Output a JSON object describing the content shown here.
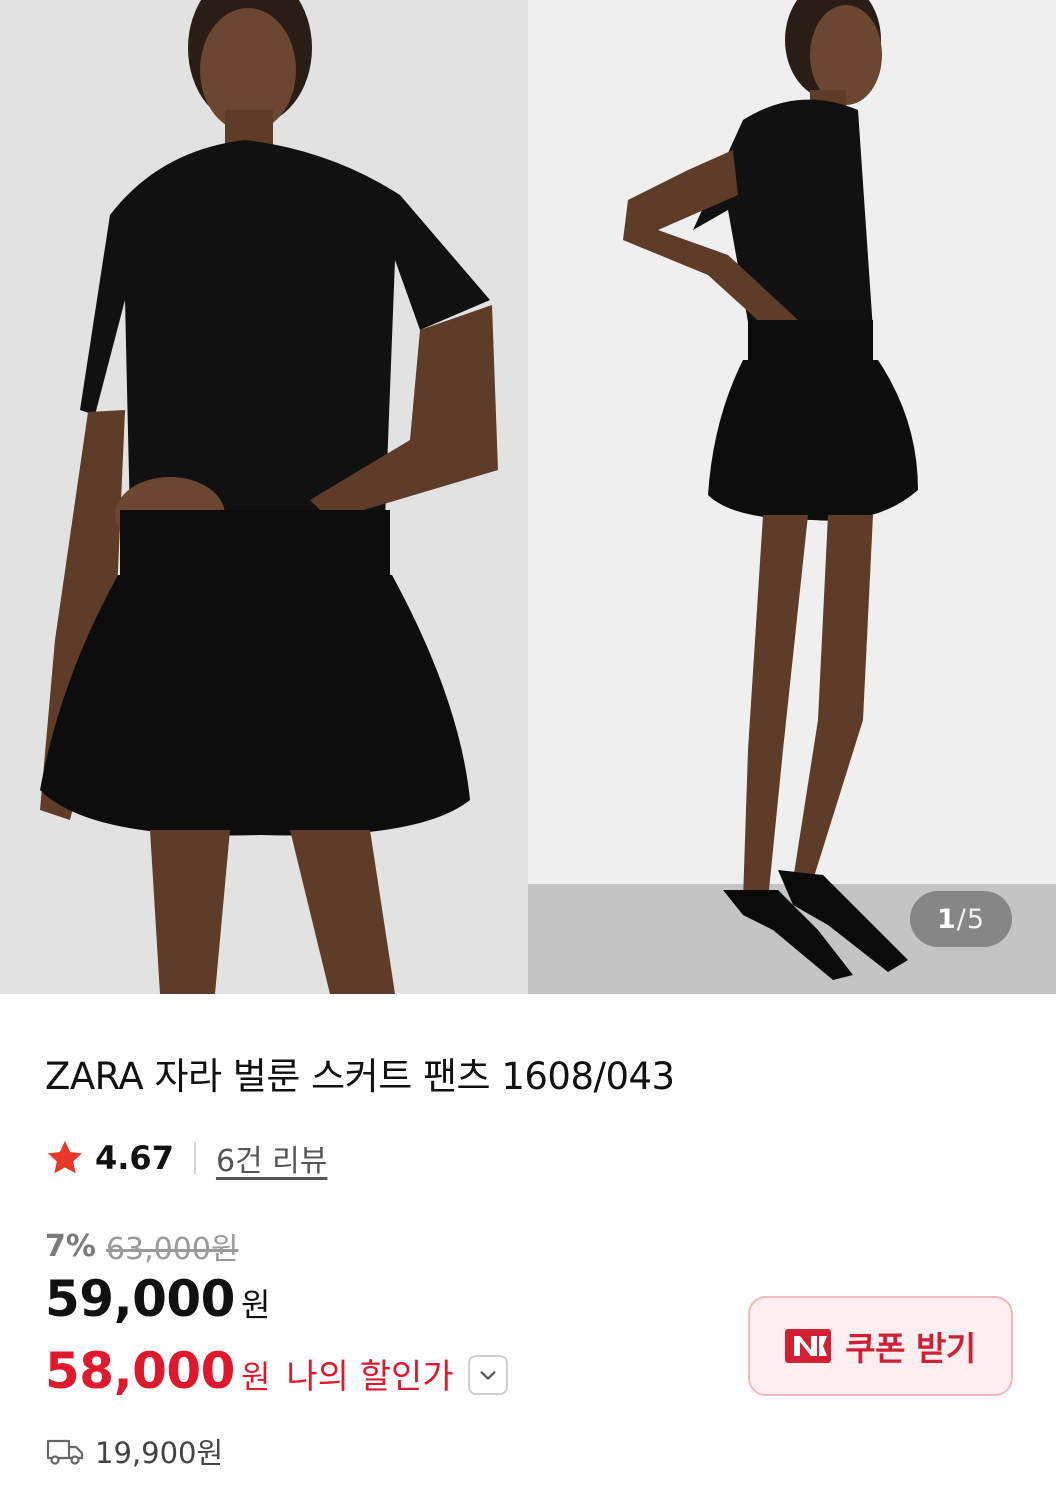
{
  "gallery": {
    "current_index": "1",
    "separator": "/",
    "total": "5",
    "images": [
      "model-front-photo",
      "model-side-photo"
    ]
  },
  "product": {
    "title": "ZARA 자라 벌룬 스커트 팬츠 1608/043"
  },
  "rating": {
    "score": "4.67",
    "review_link": "6건 리뷰",
    "star_color": "#e8372b"
  },
  "pricing": {
    "discount_rate": "7%",
    "original_price": "63,000원",
    "sale_price": "59,000",
    "sale_unit": "원",
    "my_price": "58,000",
    "my_price_unit": "원",
    "my_price_label": "나의 할인가",
    "accent_color": "#e0182e"
  },
  "coupon": {
    "label": "쿠폰 받기",
    "badge": "N",
    "border_color": "#f2b7c0"
  },
  "shipping": {
    "fee": "19,900원",
    "icon": "truck-icon"
  }
}
